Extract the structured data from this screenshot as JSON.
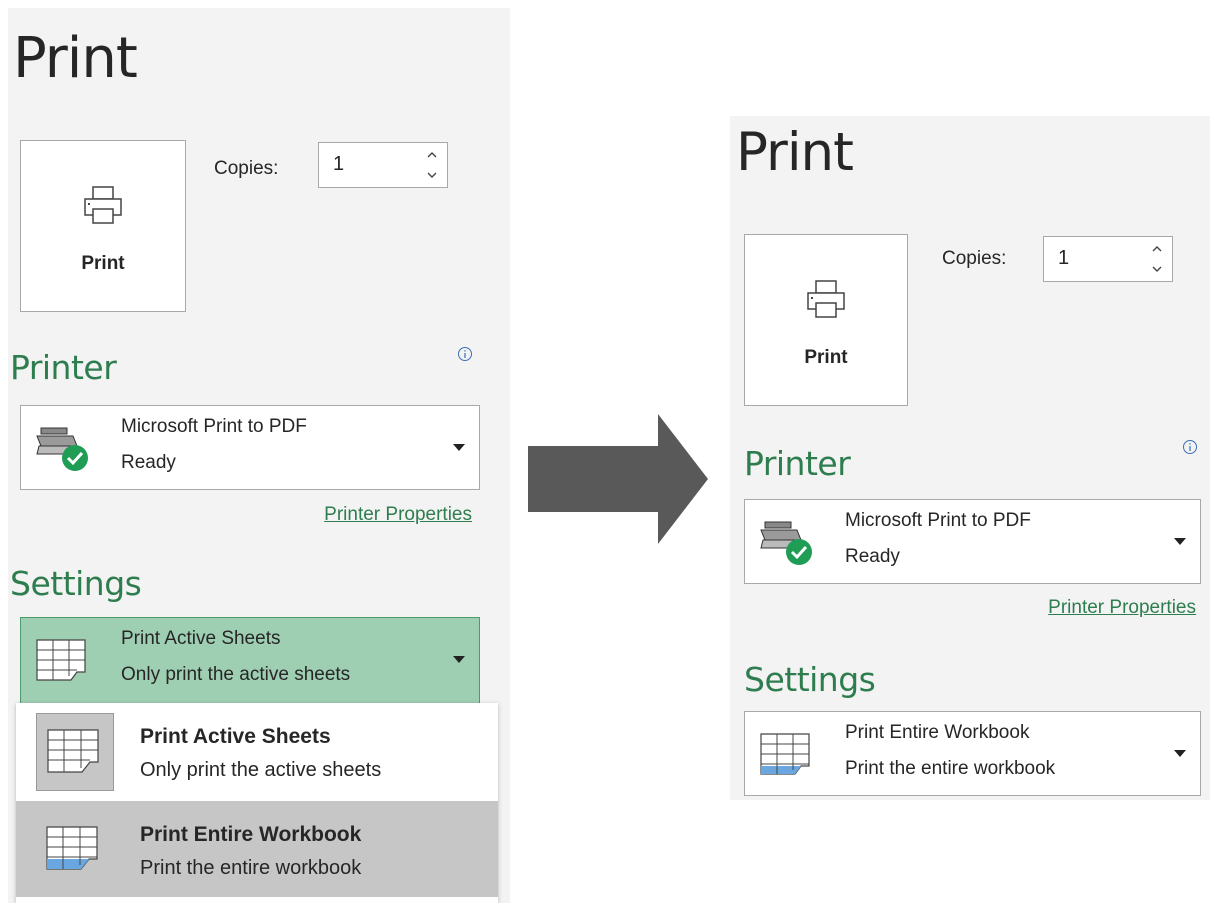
{
  "left": {
    "title": "Print",
    "print_button_label": "Print",
    "copies_label": "Copies:",
    "copies_value": "1",
    "printer_section": "Printer",
    "printer": {
      "name": "Microsoft Print to PDF",
      "status": "Ready",
      "icon": "printer-ready-icon"
    },
    "printer_properties_link": "Printer Properties",
    "settings_section": "Settings",
    "settings": {
      "line1": "Print Active Sheets",
      "line2": "Only print the active sheets"
    },
    "menu": [
      {
        "title": "Print Active Sheets",
        "subtitle": "Only print the active sheets",
        "selected": true
      },
      {
        "title": "Print Entire Workbook",
        "subtitle": "Print the entire workbook",
        "hovered": true
      }
    ]
  },
  "right": {
    "title": "Print",
    "print_button_label": "Print",
    "copies_label": "Copies:",
    "copies_value": "1",
    "printer_section": "Printer",
    "printer": {
      "name": "Microsoft Print to PDF",
      "status": "Ready",
      "icon": "printer-ready-icon"
    },
    "printer_properties_link": "Printer Properties",
    "settings_section": "Settings",
    "settings": {
      "line1": "Print Entire Workbook",
      "line2": "Print the entire workbook"
    }
  },
  "colors": {
    "accent_green": "#2e7d4f",
    "selected_dropdown": "#9fcfb2",
    "panel_bg": "#f3f3f3",
    "arrow": "#595959"
  }
}
